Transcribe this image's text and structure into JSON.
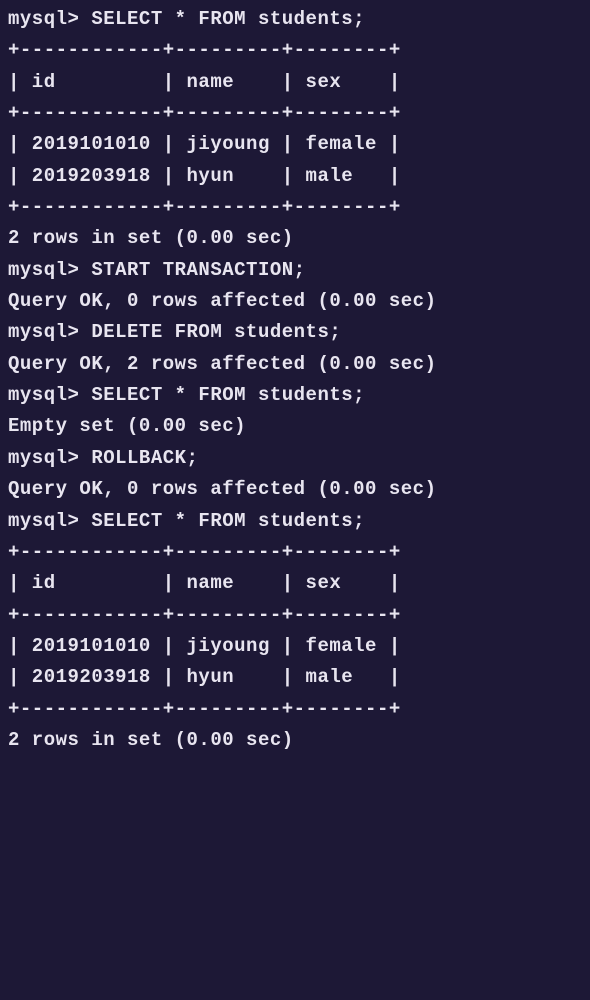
{
  "lines": [
    "mysql> SELECT * FROM students;",
    "+------------+---------+--------+",
    "| id         | name    | sex    |",
    "+------------+---------+--------+",
    "| 2019101010 | jiyoung | female |",
    "| 2019203918 | hyun    | male   |",
    "+------------+---------+--------+",
    "2 rows in set (0.00 sec)",
    "",
    "mysql> START TRANSACTION;",
    "Query OK, 0 rows affected (0.00 sec)",
    "",
    "mysql> DELETE FROM students;",
    "Query OK, 2 rows affected (0.00 sec)",
    "",
    "mysql> SELECT * FROM students;",
    "Empty set (0.00 sec)",
    "",
    "mysql> ROLLBACK;",
    "Query OK, 0 rows affected (0.00 sec)",
    "",
    "mysql> SELECT * FROM students;",
    "+------------+---------+--------+",
    "| id         | name    | sex    |",
    "+------------+---------+--------+",
    "| 2019101010 | jiyoung | female |",
    "| 2019203918 | hyun    | male   |",
    "+------------+---------+--------+",
    "2 rows in set (0.00 sec)"
  ],
  "prompt": "mysql>",
  "commands": {
    "select1": "SELECT * FROM students;",
    "start_transaction": "START TRANSACTION;",
    "delete": "DELETE FROM students;",
    "select2": "SELECT * FROM students;",
    "rollback": "ROLLBACK;",
    "select3": "SELECT * FROM students;"
  },
  "table1": {
    "headers": [
      "id",
      "name",
      "sex"
    ],
    "rows": [
      {
        "id": "2019101010",
        "name": "jiyoung",
        "sex": "female"
      },
      {
        "id": "2019203918",
        "name": "hyun",
        "sex": "male"
      }
    ]
  },
  "results": {
    "rows_in_set_1": "2 rows in set (0.00 sec)",
    "query_ok_0": "Query OK, 0 rows affected (0.00 sec)",
    "query_ok_2": "Query OK, 2 rows affected (0.00 sec)",
    "empty_set": "Empty set (0.00 sec)",
    "rows_in_set_2": "2 rows in set (0.00 sec)"
  },
  "table2": {
    "headers": [
      "id",
      "name",
      "sex"
    ],
    "rows": [
      {
        "id": "2019101010",
        "name": "jiyoung",
        "sex": "female"
      },
      {
        "id": "2019203918",
        "name": "hyun",
        "sex": "male"
      }
    ]
  }
}
